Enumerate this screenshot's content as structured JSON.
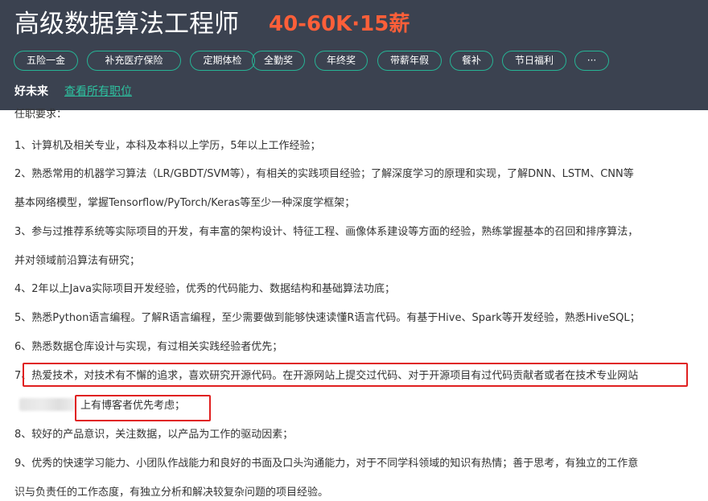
{
  "header": {
    "job_title": "高级数据算法工程师",
    "salary": "40-60K·15薪",
    "tags": [
      "五险一金",
      "补充医疗保险",
      "定期体检",
      "全勤奖",
      "年终奖",
      "带薪年假",
      "餐补",
      "节日福利",
      "···"
    ],
    "company": "好未来",
    "view_all_jobs": "查看所有职位"
  },
  "requirements": {
    "heading": "任职要求：",
    "lines": [
      "1、计算机及相关专业，本科及本科以上学历，5年以上工作经验；",
      "2、熟悉常用的机器学习算法（LR/GBDT/SVM等），有相关的实践项目经验；了解深度学习的原理和实现，了解DNN、LSTM、CNN等",
      "基本网络模型，掌握Tensorflow/PyTorch/Keras等至少一种深度学框架；",
      "3、参与过推荐系统等实际项目的开发，有丰富的架构设计、特征工程、画像体系建设等方面的经验，熟练掌握基本的召回和排序算法，",
      "并对领域前沿算法有研究；",
      "4、2年以上Java实际项目开发经验，优秀的代码能力、数据结构和基础算法功底；",
      "5、熟悉Python语言编程。了解R语言编程，至少需要做到能够快速读懂R语言代码。有基于Hive、Spark等开发经验，熟悉HiveSQL；",
      "6、熟悉数据仓库设计与实现，有过相关实践经验者优先；",
      "7、热爱技术，对技术有不懈的追求，喜欢研究开源代码。在开源网站上提交过代码、对于开源项目有过代码贡献者或者在技术专业网站",
      "上有博客者优先考虑；",
      "8、较好的产品意识，关注数据，以产品为工作的驱动因素；",
      "9、优秀的快速学习能力、小团队作战能力和良好的书面及口头沟通能力，对于不同学科领域的知识有热情；善于思考，有独立的工作意",
      "识与负责任的工作态度，有独立分析和解决较复杂问题的项目经验。"
    ]
  },
  "colors": {
    "header_bg": "#3b4250",
    "salary": "#fd5f39",
    "tag_border": "#26b495",
    "link": "#2dc3a0",
    "highlight": "#e02020",
    "body_text": "#333333"
  }
}
